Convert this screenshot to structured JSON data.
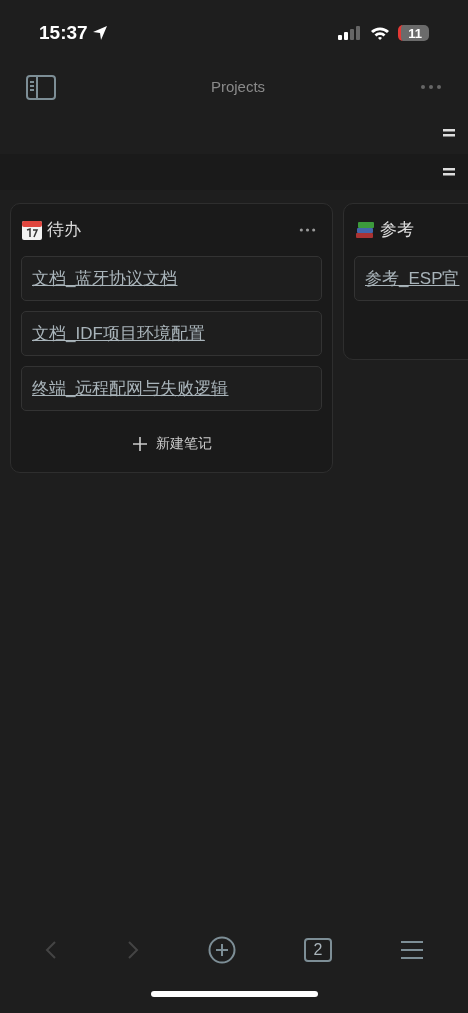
{
  "status_bar": {
    "time": "15:37",
    "battery": "11"
  },
  "header": {
    "title": "Projects"
  },
  "board": {
    "columns": [
      {
        "kind": "calendar",
        "title": "待办",
        "cards": [
          "文档_蓝牙协议文档",
          "文档_IDF项目环境配置",
          "终端_远程配网与失败逻辑"
        ],
        "new_note": "新建笔记"
      },
      {
        "kind": "books",
        "title": "参考",
        "cards": [
          "参考_ESP官"
        ]
      }
    ]
  },
  "toolbar": {
    "back": {
      "disabled": true
    },
    "forward": {
      "disabled": true
    },
    "tabs_count": "2"
  }
}
